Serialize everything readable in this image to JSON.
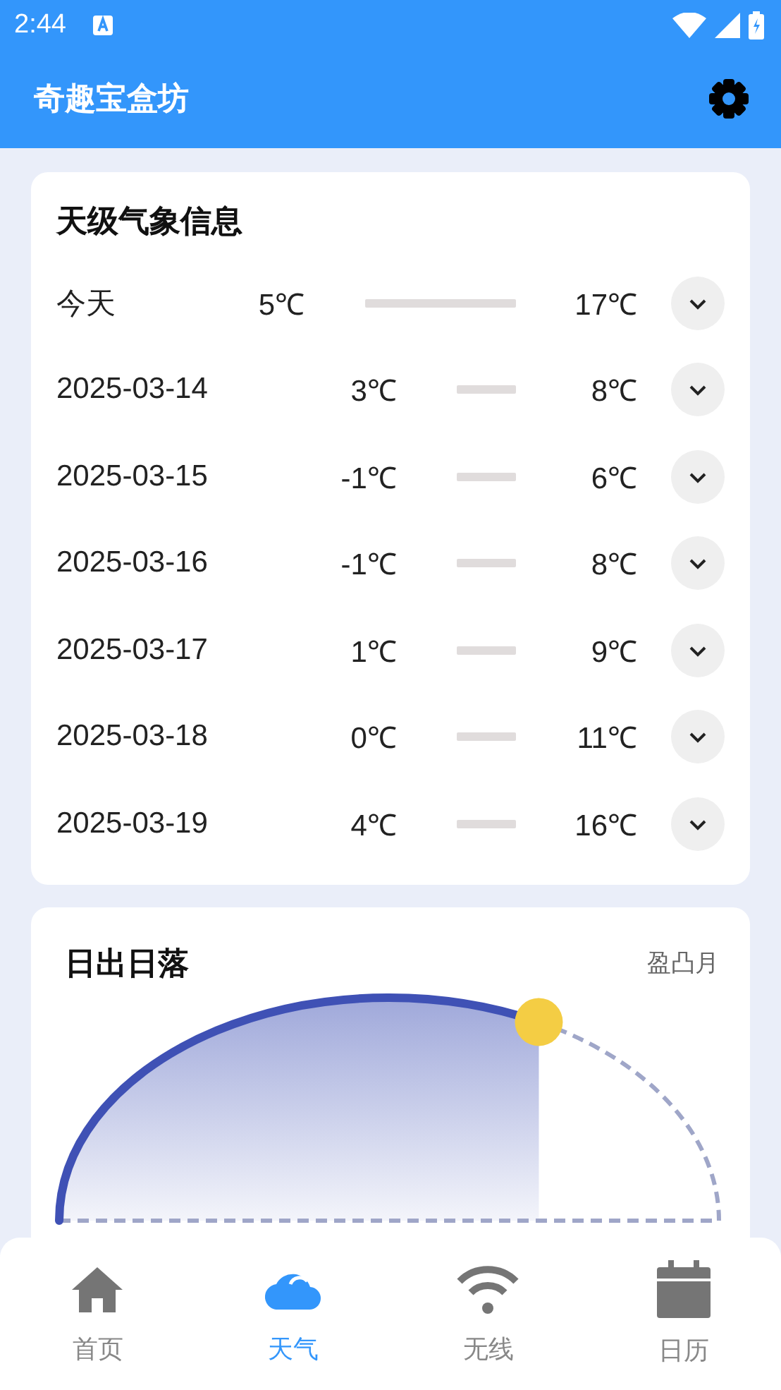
{
  "status_bar": {
    "time": "2:44"
  },
  "app_bar": {
    "title": "奇趣宝盒坊"
  },
  "forecast": {
    "title": "天级气象信息",
    "rows": [
      {
        "day": "今天",
        "low": "5℃",
        "high": "17℃",
        "expanded": false
      },
      {
        "day": "2025-03-14",
        "low": "3℃",
        "high": "8℃",
        "expanded": false
      },
      {
        "day": "2025-03-15",
        "low": "-1℃",
        "high": "6℃",
        "expanded": false
      },
      {
        "day": "2025-03-16",
        "low": "-1℃",
        "high": "8℃",
        "expanded": false
      },
      {
        "day": "2025-03-17",
        "low": "1℃",
        "high": "9℃",
        "expanded": false
      },
      {
        "day": "2025-03-18",
        "low": "0℃",
        "high": "11℃",
        "expanded": false
      },
      {
        "day": "2025-03-19",
        "low": "4℃",
        "high": "16℃",
        "expanded": false
      }
    ]
  },
  "sun": {
    "title": "日出日落",
    "moon_phase": "盈凸月"
  },
  "nav": [
    {
      "label": "首页",
      "selected": false
    },
    {
      "label": "天气",
      "selected": true
    },
    {
      "label": "无线",
      "selected": false
    },
    {
      "label": "日历",
      "selected": false
    }
  ]
}
